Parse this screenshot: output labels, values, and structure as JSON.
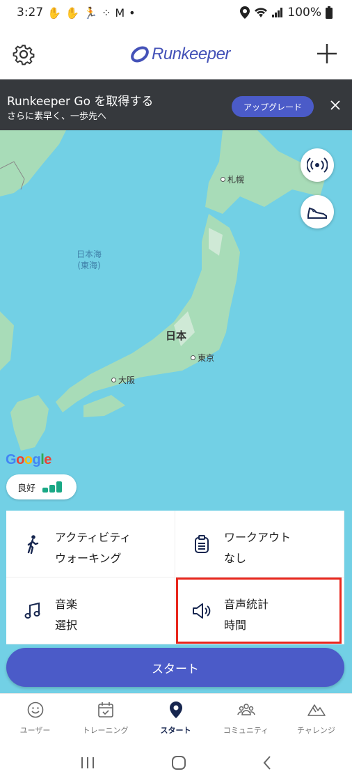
{
  "status_bar": {
    "time": "3:27",
    "notification_icons": [
      "hand-icon",
      "hand-icon",
      "runner-icon",
      "grid-dots-icon",
      "gmail-icon",
      "dot-icon"
    ],
    "battery": "100%"
  },
  "header": {
    "logo_text": "Runkeeper",
    "brand_color": "#4452b8"
  },
  "promo": {
    "title": "Runkeeper Go を取得する",
    "subtitle": "さらに素早く、一歩先へ",
    "upgrade_label": "アップグレード",
    "close_glyph": "✕"
  },
  "map": {
    "sea_label_line1": "日本海",
    "sea_label_line2": "(東海)",
    "country": "日本",
    "cities": {
      "sapporo": "札幌",
      "tokyo": "東京",
      "osaka": "大阪"
    },
    "google_logo": "Google",
    "gps_status": "良好"
  },
  "activity_grid": {
    "activity": {
      "label": "アクティビティ",
      "value": "ウォーキング"
    },
    "workout": {
      "label": "ワークアウト",
      "value": "なし"
    },
    "music": {
      "label": "音楽",
      "value": "選択"
    },
    "audio_stats": {
      "label": "音声統計",
      "value": "時間"
    }
  },
  "start_label": "スタート",
  "bottom_nav": {
    "user": "ユーザー",
    "training": "トレーニング",
    "start": "スタート",
    "community": "コミュニティ",
    "challenge": "チャレンジ"
  },
  "colors": {
    "accent": "#4b5bc8",
    "highlight": "#e8261c",
    "gps_bars": "#19a885",
    "sea": "#72d0e5"
  }
}
